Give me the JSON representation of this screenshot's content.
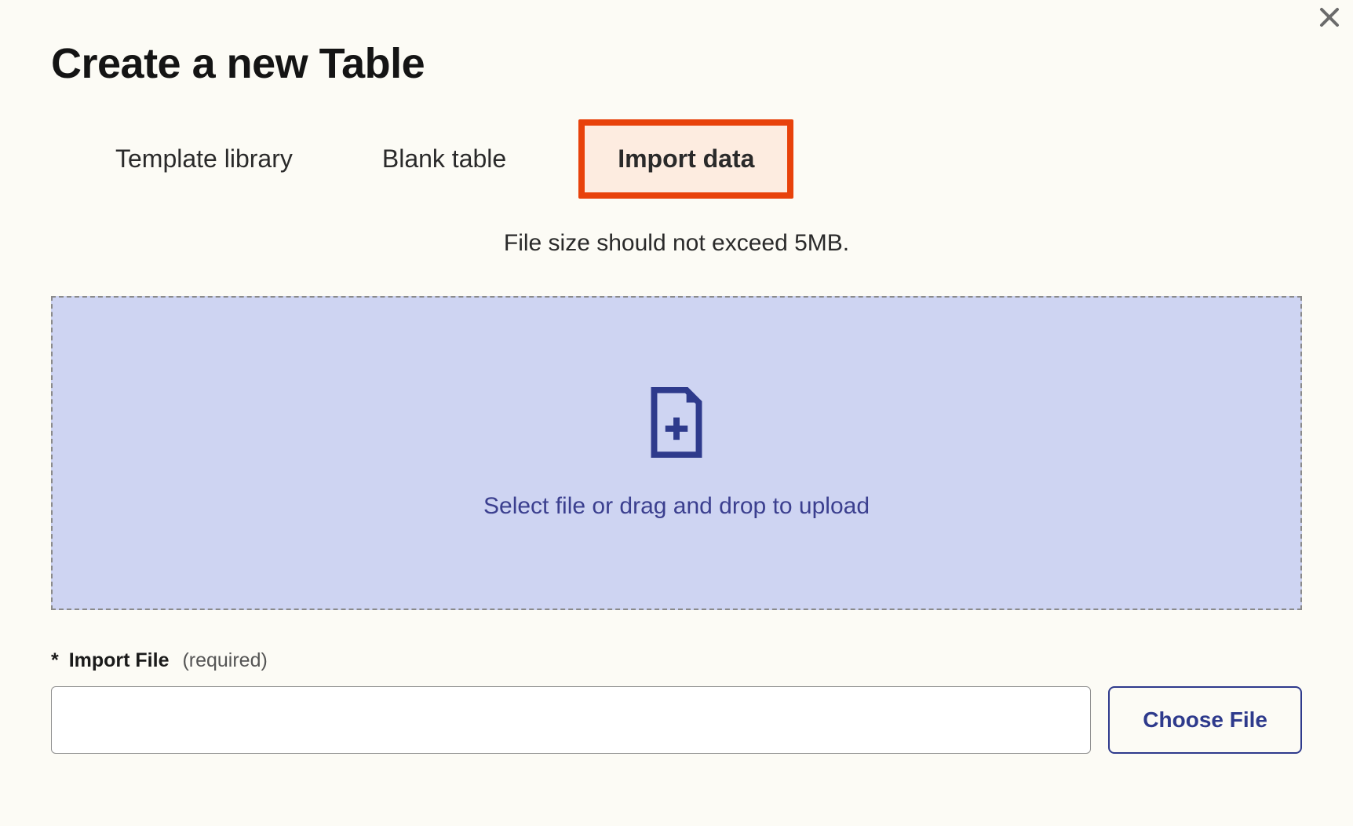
{
  "modal": {
    "title": "Create a new Table",
    "tabs": [
      {
        "label": "Template library",
        "active": false
      },
      {
        "label": "Blank table",
        "active": false
      },
      {
        "label": "Import data",
        "active": true
      }
    ],
    "file_hint": "File size should not exceed 5MB.",
    "dropzone_text": "Select file or drag and drop to upload",
    "import_label": {
      "asterisk": "*",
      "main": "Import File",
      "sub": "(required)"
    },
    "file_input_value": "",
    "choose_file_label": "Choose File"
  },
  "icons": {
    "close": "close-icon",
    "file_add": "file-add-icon"
  }
}
